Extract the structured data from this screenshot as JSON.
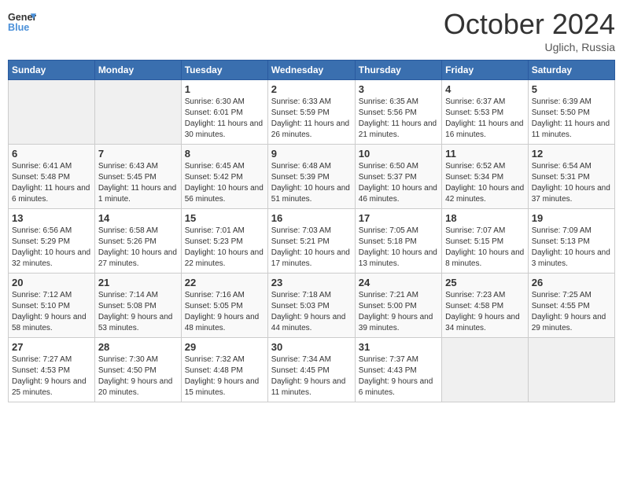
{
  "header": {
    "logo_line1": "General",
    "logo_line2": "Blue",
    "month": "October 2024",
    "location": "Uglich, Russia"
  },
  "weekdays": [
    "Sunday",
    "Monday",
    "Tuesday",
    "Wednesday",
    "Thursday",
    "Friday",
    "Saturday"
  ],
  "weeks": [
    [
      {
        "day": "",
        "empty": true
      },
      {
        "day": "",
        "empty": true
      },
      {
        "day": "1",
        "sunrise": "6:30 AM",
        "sunset": "6:01 PM",
        "daylight": "11 hours and 30 minutes."
      },
      {
        "day": "2",
        "sunrise": "6:33 AM",
        "sunset": "5:59 PM",
        "daylight": "11 hours and 26 minutes."
      },
      {
        "day": "3",
        "sunrise": "6:35 AM",
        "sunset": "5:56 PM",
        "daylight": "11 hours and 21 minutes."
      },
      {
        "day": "4",
        "sunrise": "6:37 AM",
        "sunset": "5:53 PM",
        "daylight": "11 hours and 16 minutes."
      },
      {
        "day": "5",
        "sunrise": "6:39 AM",
        "sunset": "5:50 PM",
        "daylight": "11 hours and 11 minutes."
      }
    ],
    [
      {
        "day": "6",
        "sunrise": "6:41 AM",
        "sunset": "5:48 PM",
        "daylight": "11 hours and 6 minutes."
      },
      {
        "day": "7",
        "sunrise": "6:43 AM",
        "sunset": "5:45 PM",
        "daylight": "11 hours and 1 minute."
      },
      {
        "day": "8",
        "sunrise": "6:45 AM",
        "sunset": "5:42 PM",
        "daylight": "10 hours and 56 minutes."
      },
      {
        "day": "9",
        "sunrise": "6:48 AM",
        "sunset": "5:39 PM",
        "daylight": "10 hours and 51 minutes."
      },
      {
        "day": "10",
        "sunrise": "6:50 AM",
        "sunset": "5:37 PM",
        "daylight": "10 hours and 46 minutes."
      },
      {
        "day": "11",
        "sunrise": "6:52 AM",
        "sunset": "5:34 PM",
        "daylight": "10 hours and 42 minutes."
      },
      {
        "day": "12",
        "sunrise": "6:54 AM",
        "sunset": "5:31 PM",
        "daylight": "10 hours and 37 minutes."
      }
    ],
    [
      {
        "day": "13",
        "sunrise": "6:56 AM",
        "sunset": "5:29 PM",
        "daylight": "10 hours and 32 minutes."
      },
      {
        "day": "14",
        "sunrise": "6:58 AM",
        "sunset": "5:26 PM",
        "daylight": "10 hours and 27 minutes."
      },
      {
        "day": "15",
        "sunrise": "7:01 AM",
        "sunset": "5:23 PM",
        "daylight": "10 hours and 22 minutes."
      },
      {
        "day": "16",
        "sunrise": "7:03 AM",
        "sunset": "5:21 PM",
        "daylight": "10 hours and 17 minutes."
      },
      {
        "day": "17",
        "sunrise": "7:05 AM",
        "sunset": "5:18 PM",
        "daylight": "10 hours and 13 minutes."
      },
      {
        "day": "18",
        "sunrise": "7:07 AM",
        "sunset": "5:15 PM",
        "daylight": "10 hours and 8 minutes."
      },
      {
        "day": "19",
        "sunrise": "7:09 AM",
        "sunset": "5:13 PM",
        "daylight": "10 hours and 3 minutes."
      }
    ],
    [
      {
        "day": "20",
        "sunrise": "7:12 AM",
        "sunset": "5:10 PM",
        "daylight": "9 hours and 58 minutes."
      },
      {
        "day": "21",
        "sunrise": "7:14 AM",
        "sunset": "5:08 PM",
        "daylight": "9 hours and 53 minutes."
      },
      {
        "day": "22",
        "sunrise": "7:16 AM",
        "sunset": "5:05 PM",
        "daylight": "9 hours and 48 minutes."
      },
      {
        "day": "23",
        "sunrise": "7:18 AM",
        "sunset": "5:03 PM",
        "daylight": "9 hours and 44 minutes."
      },
      {
        "day": "24",
        "sunrise": "7:21 AM",
        "sunset": "5:00 PM",
        "daylight": "9 hours and 39 minutes."
      },
      {
        "day": "25",
        "sunrise": "7:23 AM",
        "sunset": "4:58 PM",
        "daylight": "9 hours and 34 minutes."
      },
      {
        "day": "26",
        "sunrise": "7:25 AM",
        "sunset": "4:55 PM",
        "daylight": "9 hours and 29 minutes."
      }
    ],
    [
      {
        "day": "27",
        "sunrise": "7:27 AM",
        "sunset": "4:53 PM",
        "daylight": "9 hours and 25 minutes."
      },
      {
        "day": "28",
        "sunrise": "7:30 AM",
        "sunset": "4:50 PM",
        "daylight": "9 hours and 20 minutes."
      },
      {
        "day": "29",
        "sunrise": "7:32 AM",
        "sunset": "4:48 PM",
        "daylight": "9 hours and 15 minutes."
      },
      {
        "day": "30",
        "sunrise": "7:34 AM",
        "sunset": "4:45 PM",
        "daylight": "9 hours and 11 minutes."
      },
      {
        "day": "31",
        "sunrise": "7:37 AM",
        "sunset": "4:43 PM",
        "daylight": "9 hours and 6 minutes."
      },
      {
        "day": "",
        "empty": true
      },
      {
        "day": "",
        "empty": true
      }
    ]
  ]
}
